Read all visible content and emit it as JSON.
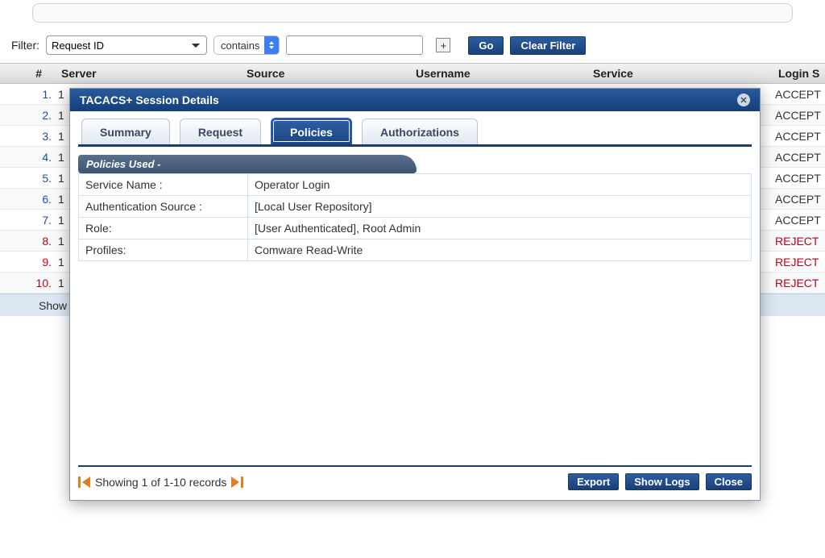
{
  "filter": {
    "label": "Filter:",
    "field_selected": "Request ID",
    "operator_selected": "contains",
    "value": "",
    "go_label": "Go",
    "clear_label": "Clear Filter"
  },
  "table": {
    "headers": {
      "idx": "#",
      "server": "Server",
      "source": "Source",
      "username": "Username",
      "service": "Service",
      "login_status": "Login S"
    },
    "rows": [
      {
        "idx": "1.",
        "server": "1",
        "status": "ACCEPT",
        "reject": false
      },
      {
        "idx": "2.",
        "server": "1",
        "status": "ACCEPT",
        "reject": false
      },
      {
        "idx": "3.",
        "server": "1",
        "status": "ACCEPT",
        "reject": false
      },
      {
        "idx": "4.",
        "server": "1",
        "status": "ACCEPT",
        "reject": false
      },
      {
        "idx": "5.",
        "server": "1",
        "status": "ACCEPT",
        "reject": false
      },
      {
        "idx": "6.",
        "server": "1",
        "status": "ACCEPT",
        "reject": false
      },
      {
        "idx": "7.",
        "server": "1",
        "status": "ACCEPT",
        "reject": false
      },
      {
        "idx": "8.",
        "server": "1",
        "status": "REJECT",
        "reject": true
      },
      {
        "idx": "9.",
        "server": "1",
        "status": "REJECT",
        "reject": true
      },
      {
        "idx": "10.",
        "server": "1",
        "status": "REJECT",
        "reject": true
      }
    ],
    "footer_text": "Show"
  },
  "modal": {
    "title": "TACACS+ Session Details",
    "tabs": [
      "Summary",
      "Request",
      "Policies",
      "Authorizations"
    ],
    "active_tab": "Policies",
    "section_title": "Policies Used -",
    "policies": [
      {
        "k": "Service Name :",
        "v": "Operator Login"
      },
      {
        "k": "Authentication Source :",
        "v": "[Local User Repository]"
      },
      {
        "k": "Role:",
        "v": "[User Authenticated], Root Admin"
      },
      {
        "k": "Profiles:",
        "v": "Comware Read-Write"
      }
    ],
    "pager_text": "Showing 1 of 1-10 records",
    "actions": {
      "export": "Export",
      "logs": "Show Logs",
      "close": "Close"
    }
  }
}
